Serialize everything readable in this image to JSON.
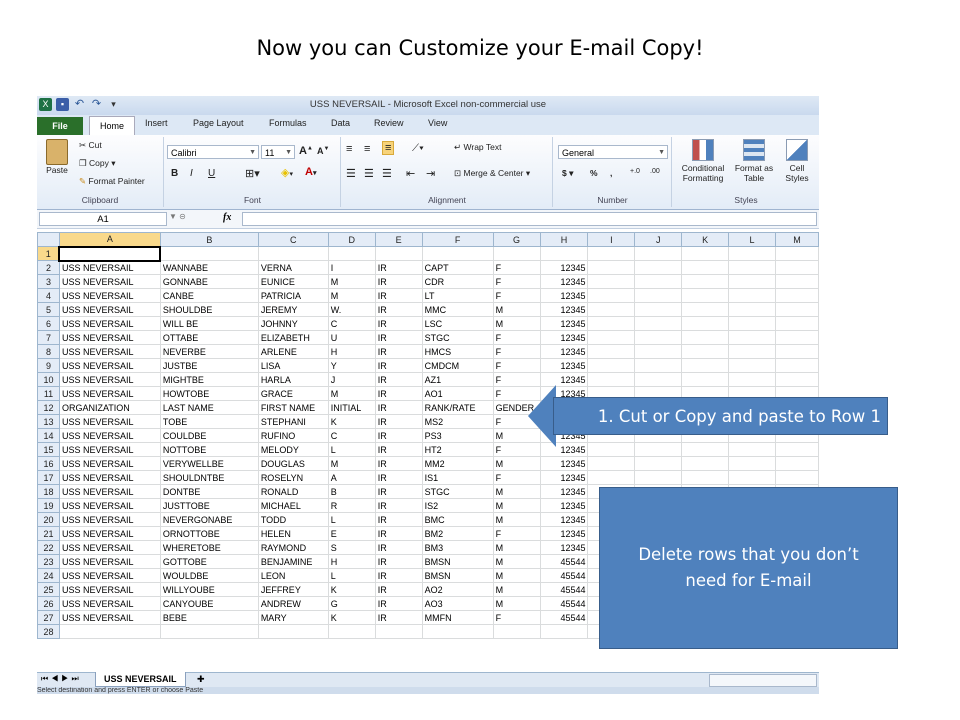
{
  "slide": {
    "title": "Now you can Customize your E-mail Copy!",
    "callout_paste": "1. Cut or Copy and paste to Row 1",
    "callout_delete": "Delete rows that you don’t need for E-mail"
  },
  "excel": {
    "window_title": "USS NEVERSAIL  -  Microsoft Excel non-commercial use",
    "tabs": [
      "File",
      "Home",
      "Insert",
      "Page Layout",
      "Formulas",
      "Data",
      "Review",
      "View"
    ],
    "ribbon": {
      "clipboard": {
        "paste": "Paste",
        "cut": "Cut",
        "copy": "Copy",
        "format_painter": "Format Painter",
        "label": "Clipboard"
      },
      "font": {
        "name": "Calibri",
        "size": "11",
        "bold": "B",
        "italic": "I",
        "underline": "U",
        "label": "Font"
      },
      "alignment": {
        "wrap_text": "Wrap Text",
        "merge_center": "Merge & Center",
        "label": "Alignment"
      },
      "number": {
        "format": "General",
        "currency": "$",
        "percent": "%",
        "comma": ",",
        "inc_decimal": "+.0",
        "dec_decimal": ".00",
        "label": "Number"
      },
      "styles": {
        "conditional": "Conditional Formatting",
        "format_table": "Format as Table",
        "cell_styles": "Cell Styles",
        "label": "Styles"
      }
    },
    "name_box": "A1",
    "fx": "fx",
    "columns": [
      "A",
      "B",
      "C",
      "D",
      "E",
      "F",
      "G",
      "H",
      "I",
      "J",
      "K",
      "L",
      "M"
    ],
    "rows": [
      [
        "",
        "",
        "",
        "",
        "",
        "",
        "",
        ""
      ],
      [
        "USS NEVERSAIL",
        "WANNABE",
        "VERNA",
        "I",
        "IR",
        "CAPT",
        "F",
        "12345"
      ],
      [
        "USS NEVERSAIL",
        "GONNABE",
        "EUNICE",
        "M",
        "IR",
        "CDR",
        "F",
        "12345"
      ],
      [
        "USS NEVERSAIL",
        "CANBE",
        "PATRICIA",
        "M",
        "IR",
        "LT",
        "F",
        "12345"
      ],
      [
        "USS NEVERSAIL",
        "SHOULDBE",
        "JEREMY",
        "W.",
        "IR",
        "MMC",
        "M",
        "12345"
      ],
      [
        "USS NEVERSAIL",
        "WILL BE",
        "JOHNNY",
        "C",
        "IR",
        "LSC",
        "M",
        "12345"
      ],
      [
        "USS NEVERSAIL",
        "OTTABE",
        "ELIZABETH",
        "U",
        "IR",
        "STGC",
        "F",
        "12345"
      ],
      [
        "USS NEVERSAIL",
        "NEVERBE",
        "ARLENE",
        "H",
        "IR",
        "HMCS",
        "F",
        "12345"
      ],
      [
        "USS NEVERSAIL",
        "JUSTBE",
        "LISA",
        "Y",
        "IR",
        "CMDCM",
        "F",
        "12345"
      ],
      [
        "USS NEVERSAIL",
        "MIGHTBE",
        "HARLA",
        "J",
        "IR",
        "AZ1",
        "F",
        "12345"
      ],
      [
        "USS NEVERSAIL",
        "HOWTOBE",
        "GRACE",
        "M",
        "IR",
        "AO1",
        "F",
        "12345"
      ],
      [
        "ORGANIZATION",
        "LAST NAME",
        "FIRST NAME",
        "INITIAL",
        "IR",
        "RANK/RATE",
        "GENDER",
        ""
      ],
      [
        "USS NEVERSAIL",
        "TOBE",
        "STEPHANI",
        "K",
        "IR",
        "MS2",
        "F",
        "12345"
      ],
      [
        "USS NEVERSAIL",
        "COULDBE",
        "RUFINO",
        "C",
        "IR",
        "PS3",
        "M",
        "12345"
      ],
      [
        "USS NEVERSAIL",
        "NOTTOBE",
        "MELODY",
        "L",
        "IR",
        "HT2",
        "F",
        "12345"
      ],
      [
        "USS NEVERSAIL",
        "VERYWELLBE",
        "DOUGLAS",
        "M",
        "IR",
        "MM2",
        "M",
        "12345"
      ],
      [
        "USS NEVERSAIL",
        "SHOULDNTBE",
        "ROSELYN",
        "A",
        "IR",
        "IS1",
        "F",
        "12345"
      ],
      [
        "USS NEVERSAIL",
        "DONTBE",
        "RONALD",
        "B",
        "IR",
        "STGC",
        "M",
        "12345"
      ],
      [
        "USS NEVERSAIL",
        "JUSTTOBE",
        "MICHAEL",
        "R",
        "IR",
        "IS2",
        "M",
        "12345"
      ],
      [
        "USS NEVERSAIL",
        "NEVERGONABE",
        "TODD",
        "L",
        "IR",
        "BMC",
        "M",
        "12345"
      ],
      [
        "USS NEVERSAIL",
        "ORNOTTOBE",
        "HELEN",
        "E",
        "IR",
        "BM2",
        "F",
        "12345"
      ],
      [
        "USS NEVERSAIL",
        "WHERETOBE",
        "RAYMOND",
        "S",
        "IR",
        "BM3",
        "M",
        "12345"
      ],
      [
        "USS NEVERSAIL",
        "GOTTOBE",
        "BENJAMINE",
        "H",
        "IR",
        "BMSN",
        "M",
        "45544"
      ],
      [
        "USS NEVERSAIL",
        "WOULDBE",
        "LEON",
        "L",
        "IR",
        "BMSN",
        "M",
        "45544"
      ],
      [
        "USS NEVERSAIL",
        "WILLYOUBE",
        "JEFFREY",
        "K",
        "IR",
        "AO2",
        "M",
        "45544"
      ],
      [
        "USS NEVERSAIL",
        "CANYOUBE",
        "ANDREW",
        "G",
        "IR",
        "AO3",
        "M",
        "45544"
      ],
      [
        "USS NEVERSAIL",
        "BEBE",
        "MARY",
        "K",
        "IR",
        "MMFN",
        "F",
        "45544"
      ],
      [
        "",
        "",
        "",
        "",
        "",
        "",
        "",
        ""
      ]
    ],
    "sheet_tab": "USS NEVERSAIL",
    "status": "Select destination and press ENTER or choose Paste"
  }
}
